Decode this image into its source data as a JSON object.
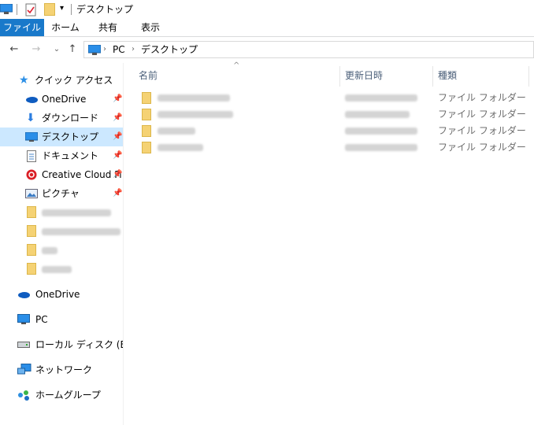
{
  "window": {
    "title": "デスクトップ"
  },
  "ribbon": {
    "tabs": [
      {
        "label": "ファイル"
      },
      {
        "label": "ホーム"
      },
      {
        "label": "共有"
      },
      {
        "label": "表示"
      }
    ]
  },
  "address": {
    "crumbs": [
      "PC",
      "デスクトップ"
    ]
  },
  "sidebar": {
    "quick_access": "クイック アクセス",
    "items": [
      {
        "label": "OneDrive",
        "pinned": true
      },
      {
        "label": "ダウンロード",
        "pinned": true
      },
      {
        "label": "デスクトップ",
        "pinned": true,
        "selected": true
      },
      {
        "label": "ドキュメント",
        "pinned": true
      },
      {
        "label": "Creative Cloud Fi",
        "pinned": true
      },
      {
        "label": "ピクチャ",
        "pinned": true
      }
    ],
    "onedrive": "OneDrive",
    "pc": "PC",
    "local_disk": "ローカル ディスク (E:)",
    "network": "ネットワーク",
    "homegroup": "ホームグループ"
  },
  "columns": {
    "name": "名前",
    "date": "更新日時",
    "type": "種類"
  },
  "files": [
    {
      "type": "ファイル フォルダー"
    },
    {
      "type": "ファイル フォルダー"
    },
    {
      "type": "ファイル フォルダー"
    },
    {
      "type": "ファイル フォルダー"
    }
  ],
  "colors": {
    "file_tab": "#1979ca",
    "selection": "#cce8ff",
    "folder": "#f5d274",
    "header_text": "#4c607a"
  },
  "icons": [
    "pc-icon",
    "checklist-icon",
    "folder-icon",
    "quick-access-star-icon",
    "onedrive-cloud-icon",
    "download-arrow-icon",
    "desktop-icon",
    "document-icon",
    "creative-cloud-icon",
    "pictures-icon",
    "pin-icon",
    "drive-icon",
    "network-icon",
    "homegroup-icon",
    "back-arrow-icon",
    "forward-arrow-icon",
    "up-arrow-icon",
    "chevron-down-icon"
  ]
}
